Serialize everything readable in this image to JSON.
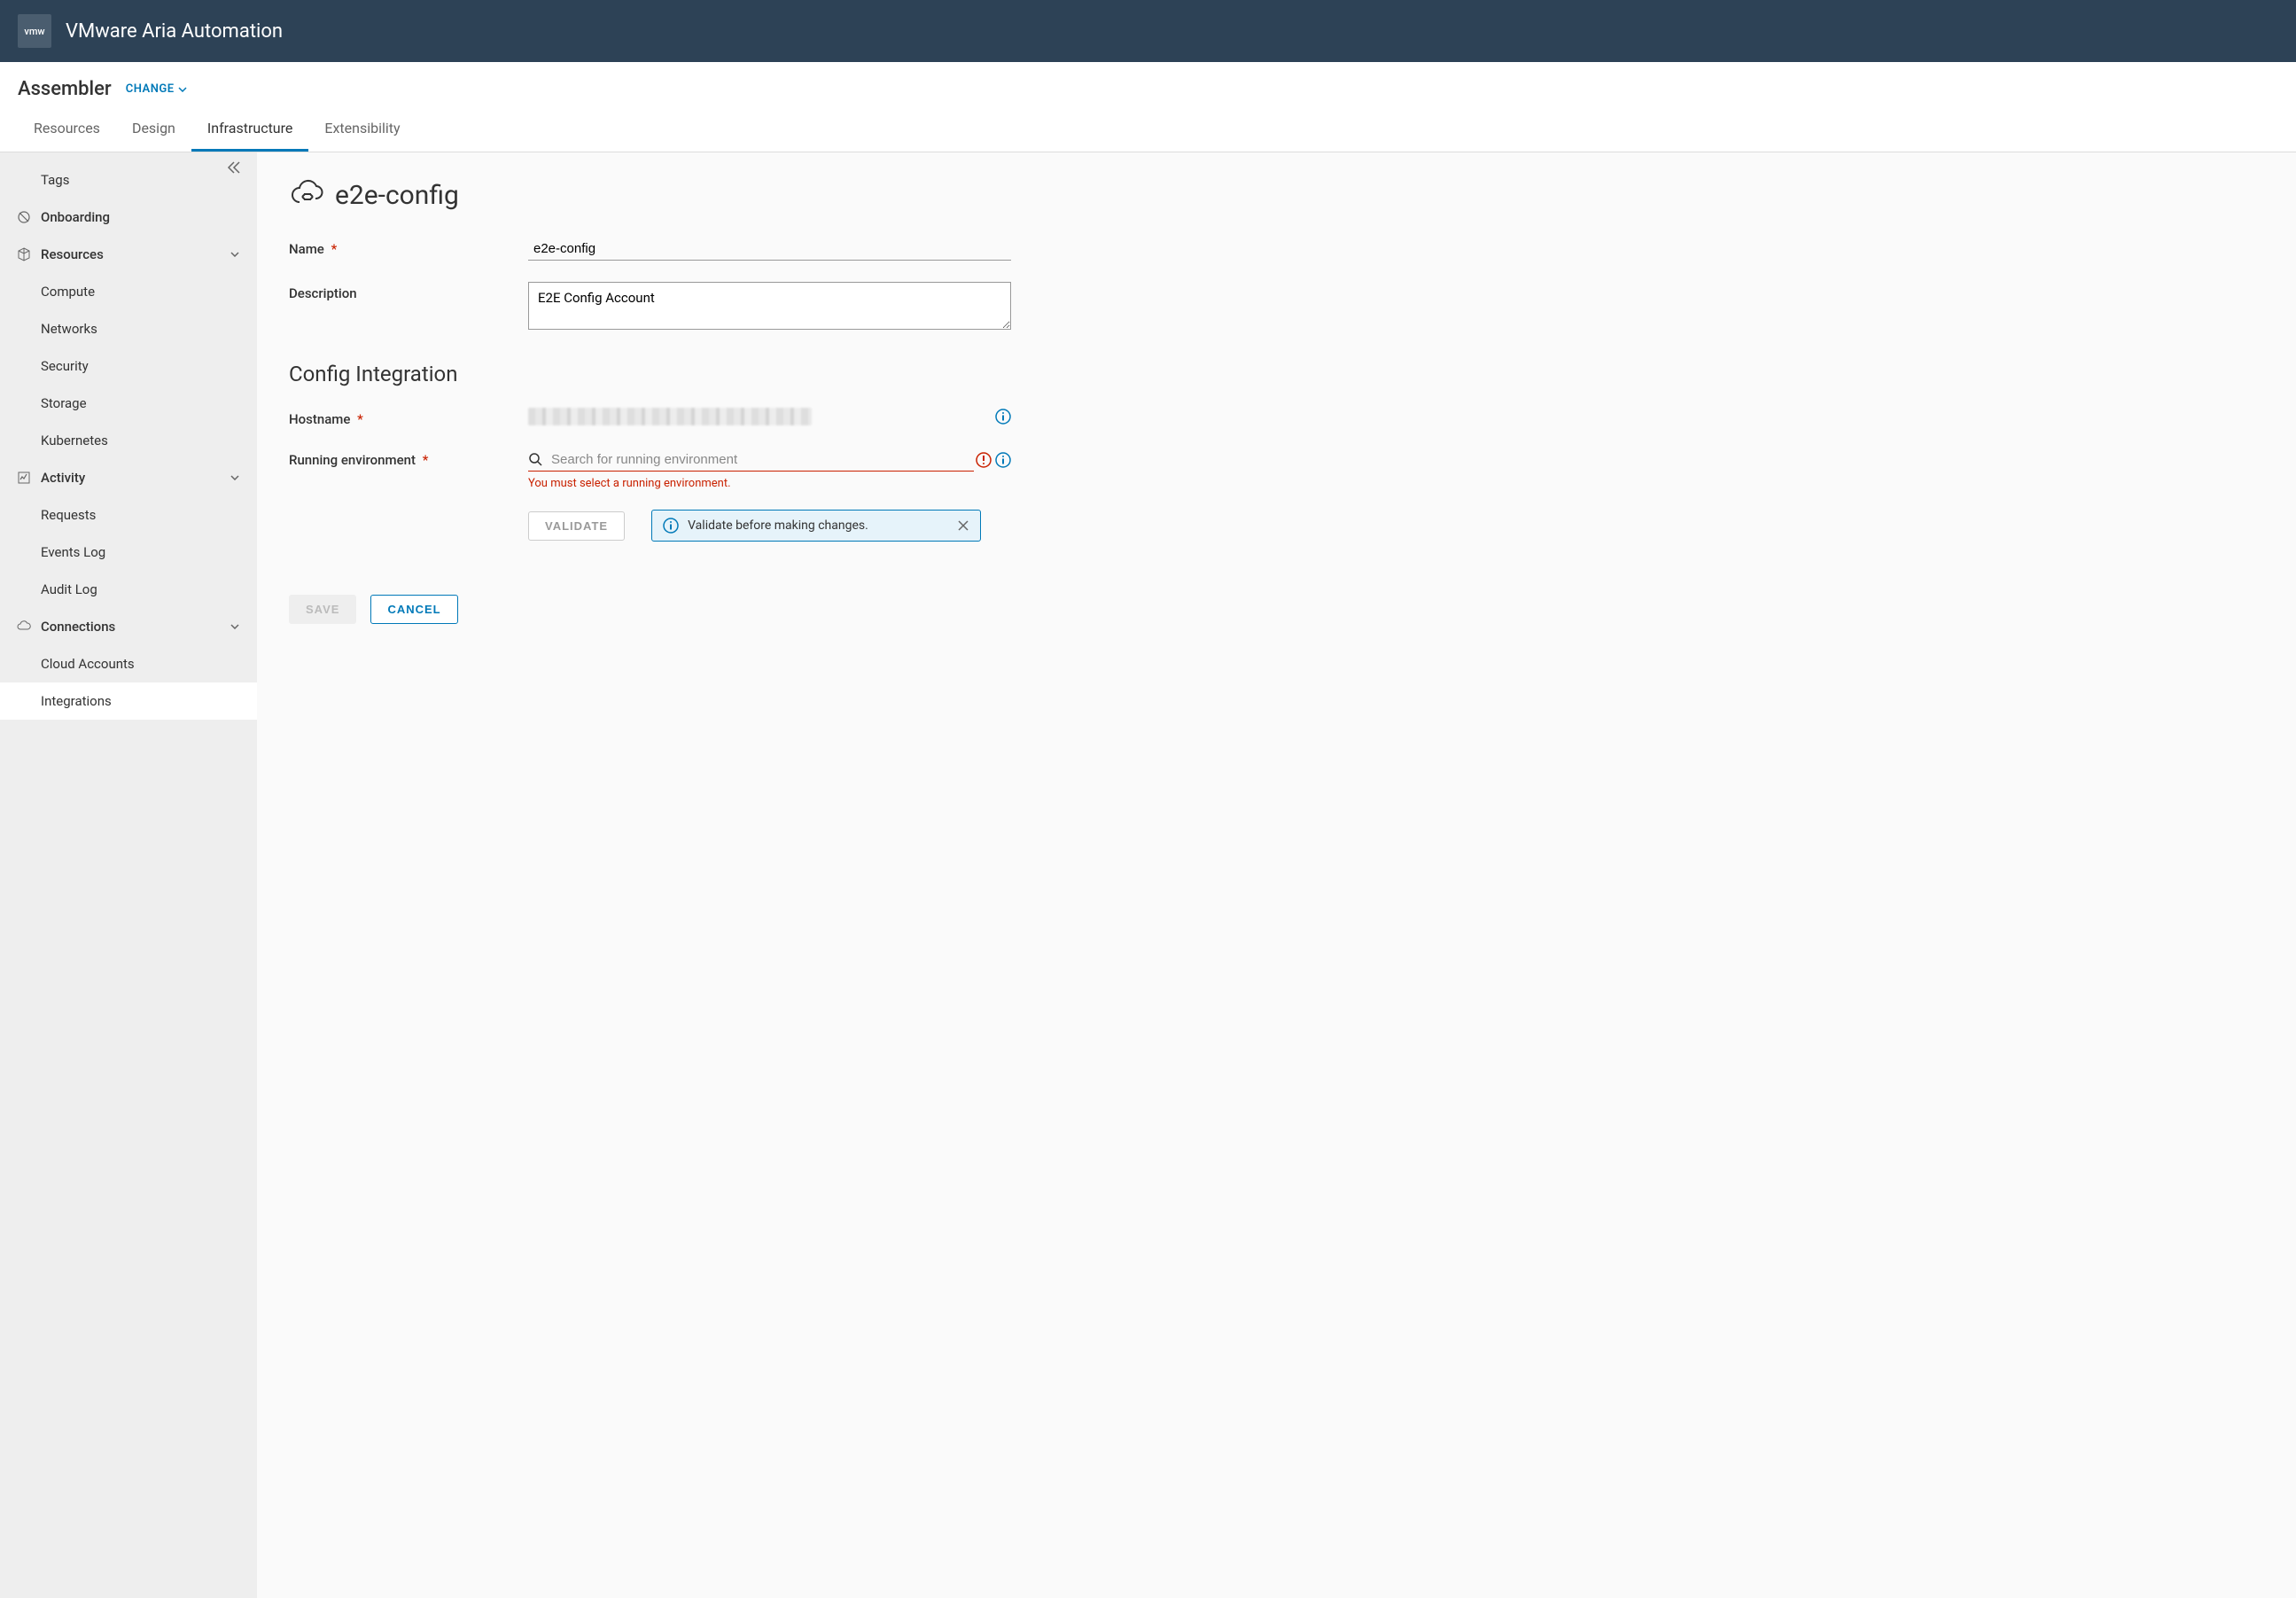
{
  "header": {
    "logo_text": "vmw",
    "product_name": "VMware Aria Automation"
  },
  "subheader": {
    "app_name": "Assembler",
    "change_label": "CHANGE"
  },
  "tabs": [
    {
      "label": "Resources",
      "active": false
    },
    {
      "label": "Design",
      "active": false
    },
    {
      "label": "Infrastructure",
      "active": true
    },
    {
      "label": "Extensibility",
      "active": false
    }
  ],
  "sidebar": {
    "tags_label": "Tags",
    "onboarding_label": "Onboarding",
    "resources": {
      "label": "Resources",
      "items": [
        "Compute",
        "Networks",
        "Security",
        "Storage",
        "Kubernetes"
      ]
    },
    "activity": {
      "label": "Activity",
      "items": [
        "Requests",
        "Events Log",
        "Audit Log"
      ]
    },
    "connections": {
      "label": "Connections",
      "items": [
        "Cloud Accounts",
        "Integrations"
      ]
    }
  },
  "page": {
    "title": "e2e-config",
    "form": {
      "name_label": "Name",
      "name_value": "e2e-config",
      "description_label": "Description",
      "description_value": "E2E Config Account",
      "section_heading": "Config Integration",
      "hostname_label": "Hostname",
      "running_env_label": "Running environment",
      "running_env_placeholder": "Search for running environment",
      "running_env_error": "You must select a running environment.",
      "validate_label": "VALIDATE",
      "banner_text": "Validate before making changes.",
      "save_label": "SAVE",
      "cancel_label": "CANCEL"
    }
  }
}
